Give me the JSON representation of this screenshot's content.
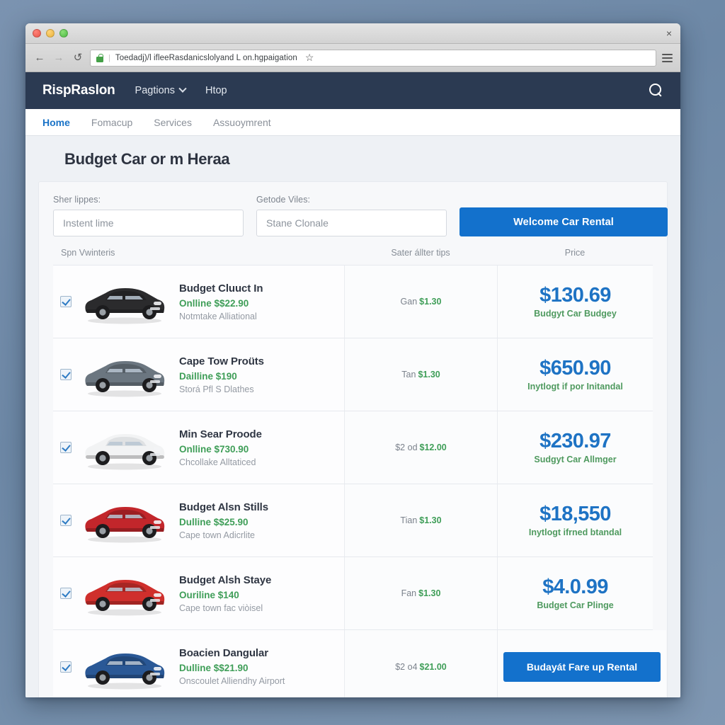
{
  "browser": {
    "close_label": "×",
    "back_icon": "back-arrow-icon",
    "forward_icon": "forward-arrow-icon",
    "reload_icon": "reload-icon",
    "url": "Toedadj)/l ifleeRasdanicslolyand L on.hgpaigation",
    "url_separator": "|",
    "star_label": "☆"
  },
  "site_nav": {
    "brand": "RispRaslon",
    "links": [
      {
        "label": "Pagtions",
        "has_caret": true
      },
      {
        "label": "Htop",
        "has_caret": false
      }
    ],
    "search_icon": "search-icon"
  },
  "subnav": {
    "items": [
      {
        "label": "Home",
        "active": true
      },
      {
        "label": "Fomacup",
        "active": false
      },
      {
        "label": "Services",
        "active": false
      },
      {
        "label": "Assuoymrent",
        "active": false
      }
    ]
  },
  "page": {
    "title": "Budget Car or m Heraa"
  },
  "search_form": {
    "pickup_label": "Sher lippes:",
    "pickup_placeholder": "Instent lime",
    "pickup_value": "",
    "dropoff_label": "Getode Viles:",
    "dropoff_placeholder": "Stane Clonale",
    "dropoff_value": "",
    "submit_label": "Welcome Car Rental"
  },
  "table": {
    "headers": {
      "car": "Spn Vwinteris",
      "extra": "Sater állter tips",
      "price": "Price"
    },
    "rows": [
      {
        "checked": true,
        "car_color": "#2b2b2d",
        "name": "Budget Cluuct In",
        "price_line": "Onlline $$22.90",
        "sub": "Notmtake Alliational",
        "extra_prefix": "Gan",
        "extra_value": "$1.30",
        "price": "$130.69",
        "note": "Budgyt Car Budgey",
        "action": null
      },
      {
        "checked": true,
        "car_color": "#6b7680",
        "name": "Cape Tow Proüts",
        "price_line": "Dailline $190",
        "sub": "Storá Pfl S Dlathes",
        "extra_prefix": "Tan",
        "extra_value": "$1.30",
        "price": "$650.90",
        "note": "Inytlogt if por Initandal",
        "action": null
      },
      {
        "checked": true,
        "car_color": "#f2f3f4",
        "name": "Min Sear Proode",
        "price_line": "Onlline $730.90",
        "sub": "Chcollake Alltaticed",
        "extra_prefix": "$2 od",
        "extra_value": "$12.00",
        "price": "$230.97",
        "note": "Sudgyt Car Allmger",
        "action": null
      },
      {
        "checked": true,
        "car_color": "#c2262b",
        "name": "Budget Alsn Stills",
        "price_line": "Dulline $$25.90",
        "sub": "Cape town Adicrlite",
        "extra_prefix": "Tian",
        "extra_value": "$1.30",
        "price": "$18,550",
        "note": "Inytlogt ifrned btandal",
        "action": null
      },
      {
        "checked": true,
        "car_color": "#cf2f2c",
        "name": "Budget Alsh Staye",
        "price_line": "Ouriline $140",
        "sub": "Cape town fac viòisel",
        "extra_prefix": "Fan",
        "extra_value": "$1.30",
        "price": "$4.0.99",
        "note": "Budget Car Plinge",
        "action": null
      },
      {
        "checked": true,
        "car_color": "#2a5896",
        "name": "Boacien Dangular",
        "price_line": "Dulline $$21.90",
        "sub": "Onscoulet Alliendhy Airport",
        "extra_prefix": "$2 o4",
        "extra_value": "$21.00",
        "price": null,
        "note": null,
        "action": "Budayát Fare up Rental"
      }
    ]
  },
  "colors": {
    "navbar": "#2b3a52",
    "accent_blue": "#1371cc",
    "price_blue": "#1e73c4",
    "green": "#3f9e58",
    "page_bg": "#eef1f5"
  }
}
